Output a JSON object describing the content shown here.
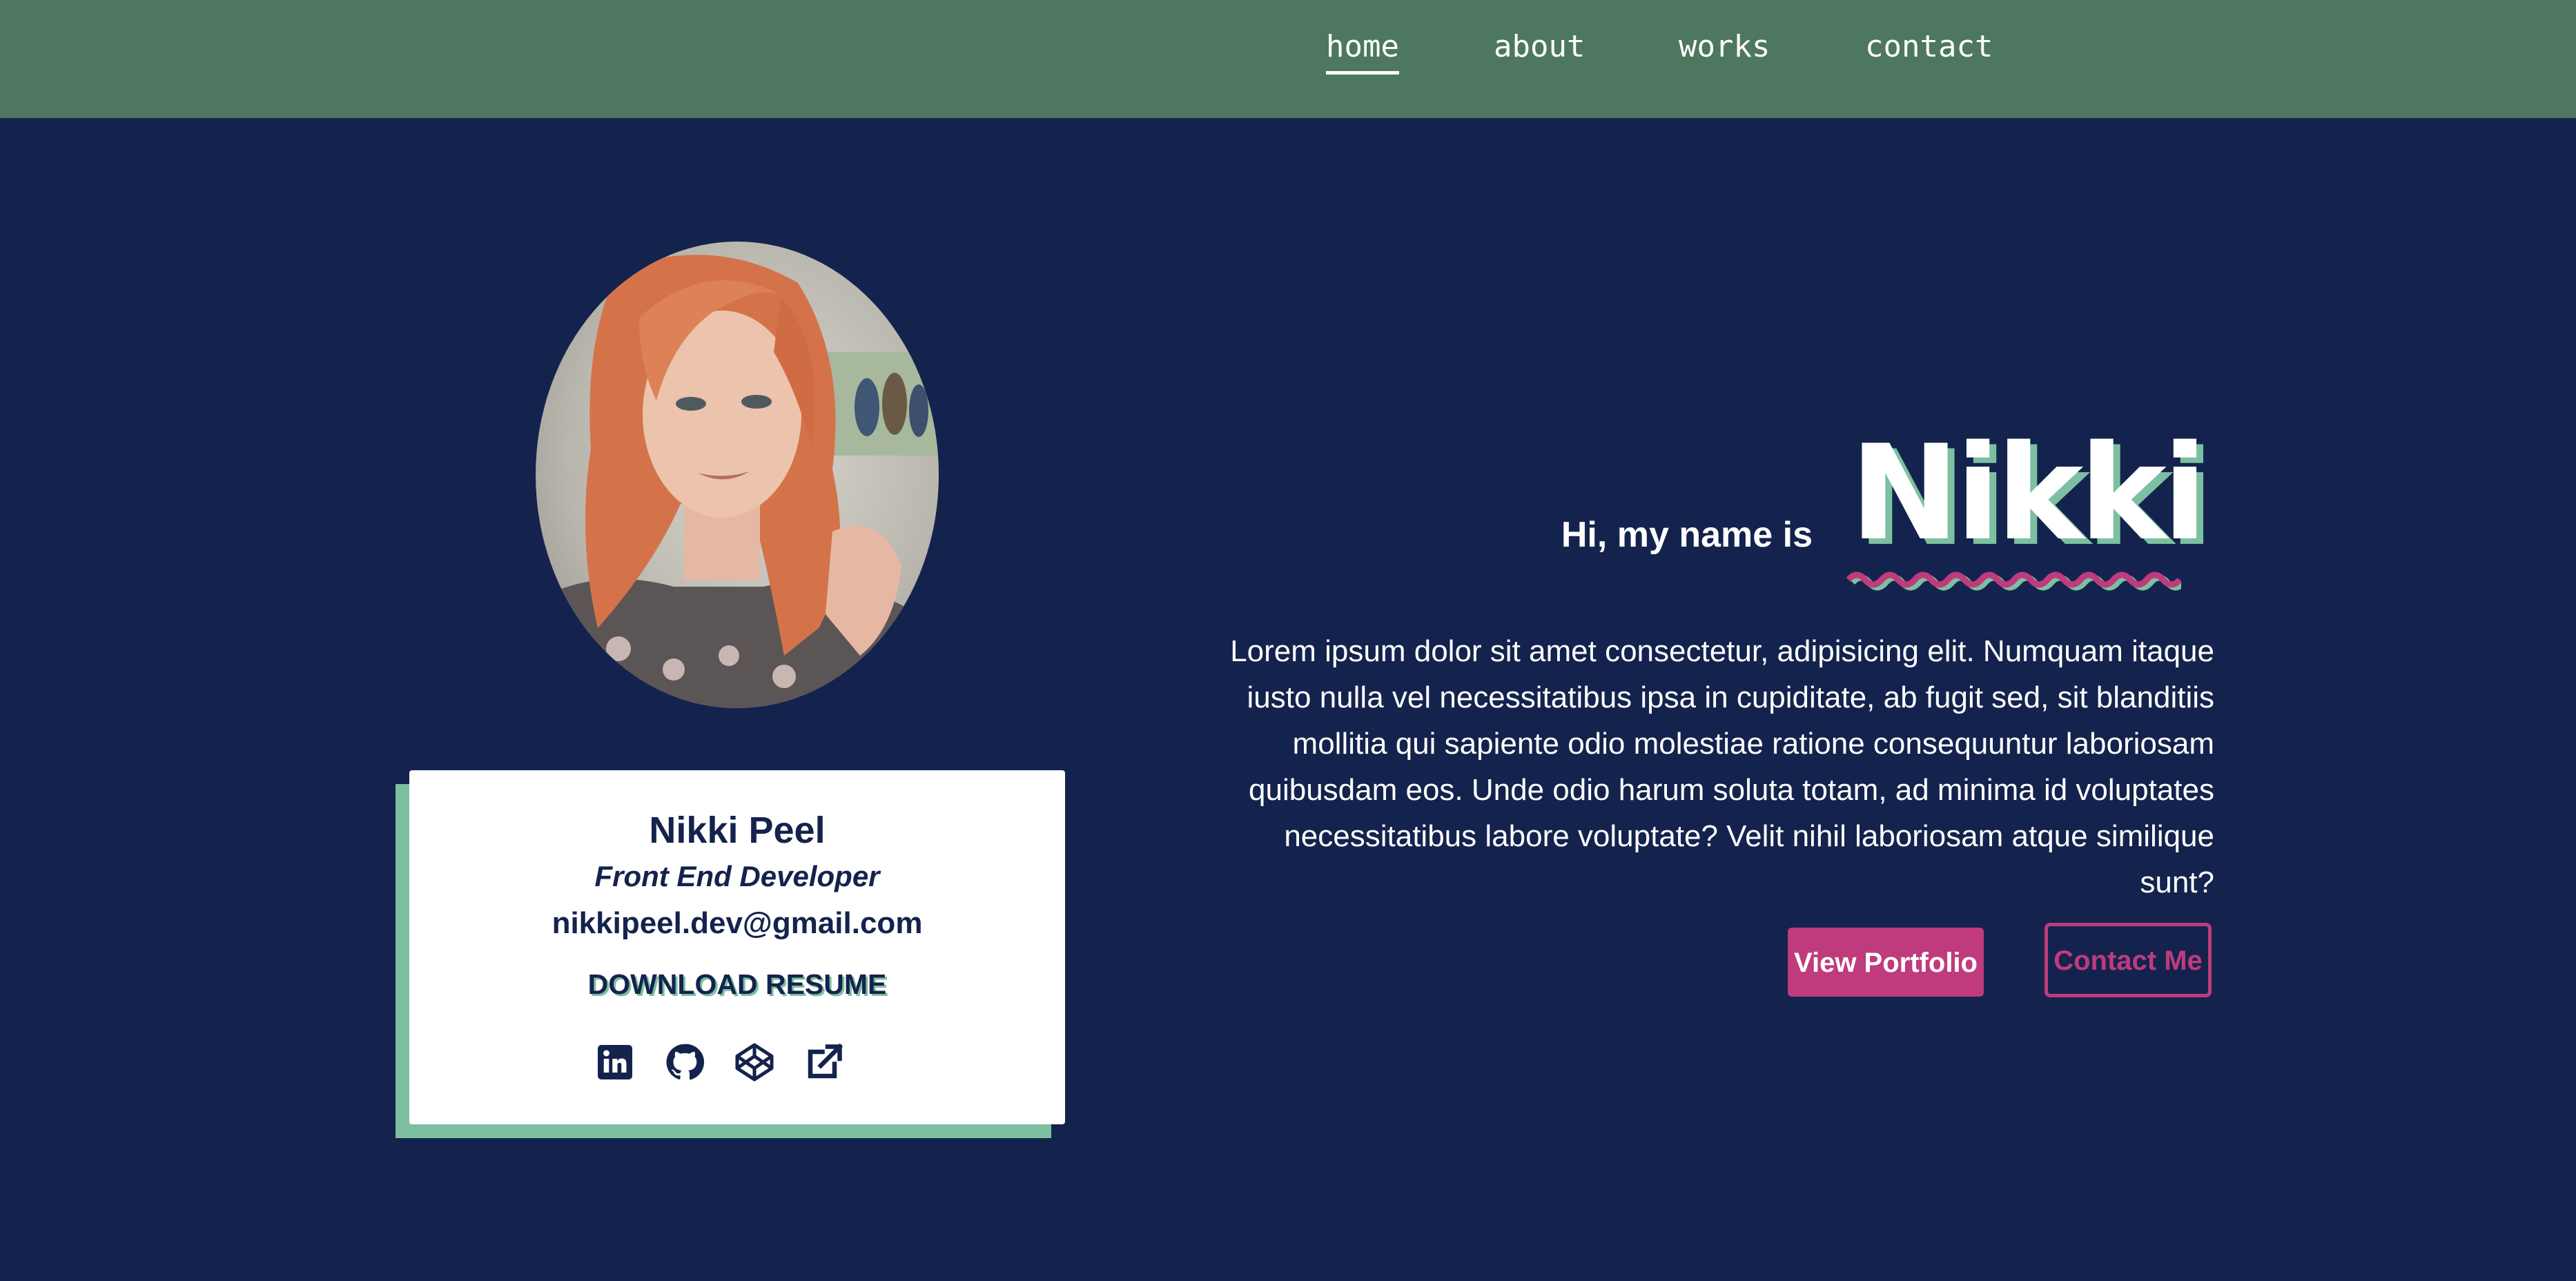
{
  "nav": {
    "items": [
      {
        "label": "home",
        "active": true
      },
      {
        "label": "about",
        "active": false
      },
      {
        "label": "works",
        "active": false
      },
      {
        "label": "contact",
        "active": false
      }
    ]
  },
  "profile_card": {
    "name": "Nikki Peel",
    "role": "Front End Developer",
    "email": "nikkipeel.dev@gmail.com",
    "resume_link": "DOWNLOAD RESUME",
    "social_icons": [
      "linkedin-icon",
      "github-icon",
      "codepen-icon",
      "external-link-icon"
    ]
  },
  "hero": {
    "greeting": "Hi, my name is",
    "name": "Nikki",
    "bio": "Lorem ipsum dolor sit amet consectetur, adipisicing elit. Numquam itaque iusto nulla vel necessitatibus ipsa in cupiditate, ab fugit sed, sit blanditiis mollitia qui sapiente odio molestiae ratione consequuntur laboriosam quibusdam eos. Unde odio harum soluta totam, ad minima id voluptates necessitatibus labore voluptate? Velit nihil laboriosam atque similique sunt?",
    "primary_button": "View Portfolio",
    "secondary_button": "Contact Me"
  },
  "colors": {
    "background": "#14234d",
    "nav": "#4d775f",
    "accent_green": "#7cc0a1",
    "accent_pink": "#bf3b7d",
    "text_light": "#ffffff"
  }
}
